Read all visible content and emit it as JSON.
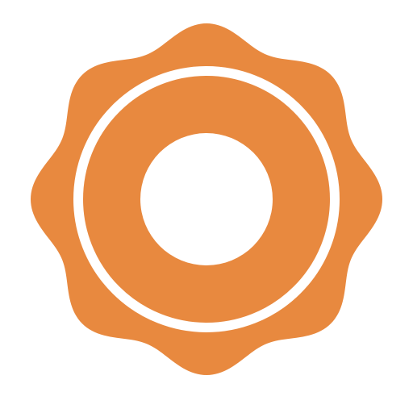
{
  "icon": {
    "name": "scalloped-ring-badge-icon",
    "primary_color": "#E8893F",
    "background_color": "#FFFFFF"
  }
}
